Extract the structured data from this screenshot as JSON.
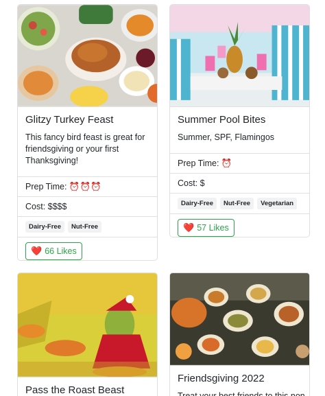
{
  "cards": [
    {
      "title": "Glitzy Turkey Feast",
      "description": "This fancy bird feast is great for friendsgiving or your first Thanksgiving!",
      "prep_time": "Prep Time: ⏰⏰⏰",
      "cost": "Cost: $$$$",
      "tags": [
        "Dairy-Free",
        "Nut-Free"
      ],
      "likes": "66 Likes"
    },
    {
      "title": "Summer Pool Bites",
      "description": "Summer, SPF, Flamingos",
      "prep_time": "Prep Time: ⏰",
      "cost": "Cost: $",
      "tags": [
        "Dairy-Free",
        "Nut-Free",
        "Vegetarian"
      ],
      "likes": "57 Likes"
    },
    {
      "title": "Pass the Roast Beast"
    },
    {
      "title": "Friendsgiving 2022",
      "description": "Treat your best friends to this non-"
    }
  ],
  "colors": {
    "accent": "#28a745",
    "border": "#dfdfdf",
    "heart": "#d0021b"
  },
  "icons": {
    "like": "heart-icon",
    "prep": "alarm-clock-icon"
  }
}
